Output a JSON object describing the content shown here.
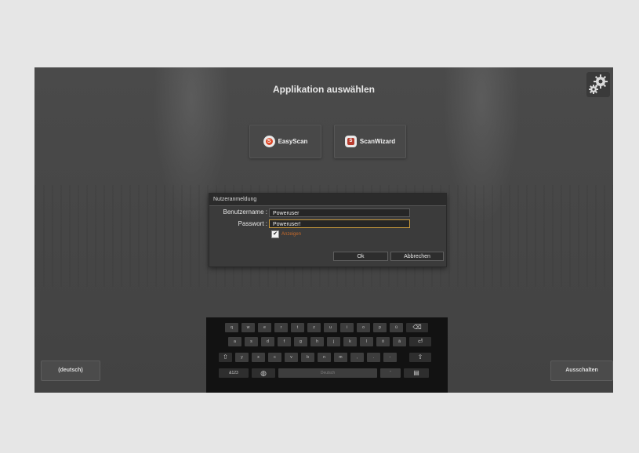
{
  "header": {
    "title": "Applikation auswählen"
  },
  "apps": [
    {
      "label": "EasyScan",
      "logo_letter": "S"
    },
    {
      "label": "ScanWizard",
      "logo_letter": "S"
    }
  ],
  "login": {
    "title": "Nutzeranmeldung",
    "username_label": "Benutzername :",
    "username_value": "Poweruser",
    "password_label": "Passwort :",
    "password_value": "Poweruser!",
    "show_label": "Anzeigen",
    "show_checked": "✔",
    "ok_label": "Ok",
    "cancel_label": "Abbrechen"
  },
  "keyboard": {
    "row1": [
      "q",
      "w",
      "e",
      "r",
      "t",
      "z",
      "u",
      "i",
      "o",
      "p",
      "ü",
      "⌫"
    ],
    "row2": [
      "a",
      "s",
      "d",
      "f",
      "g",
      "h",
      "j",
      "k",
      "l",
      "ö",
      "ä",
      "⏎"
    ],
    "row3": [
      "⇧",
      "y",
      "x",
      "c",
      "v",
      "b",
      "n",
      "m",
      ",",
      ".",
      "-",
      "⇧"
    ],
    "row4": {
      "numbers": "&123",
      "globe": "◍",
      "space": "Deutsch",
      "apostrophe": "'",
      "hide": "▤"
    }
  },
  "footer": {
    "language_label": "(deutsch)",
    "shutdown_label": "Ausschalten"
  },
  "colors": {
    "background": "#e6e6e6",
    "screen": "#454545",
    "accent_orange": "#c76a2a",
    "focus_border": "#c99a3c"
  }
}
